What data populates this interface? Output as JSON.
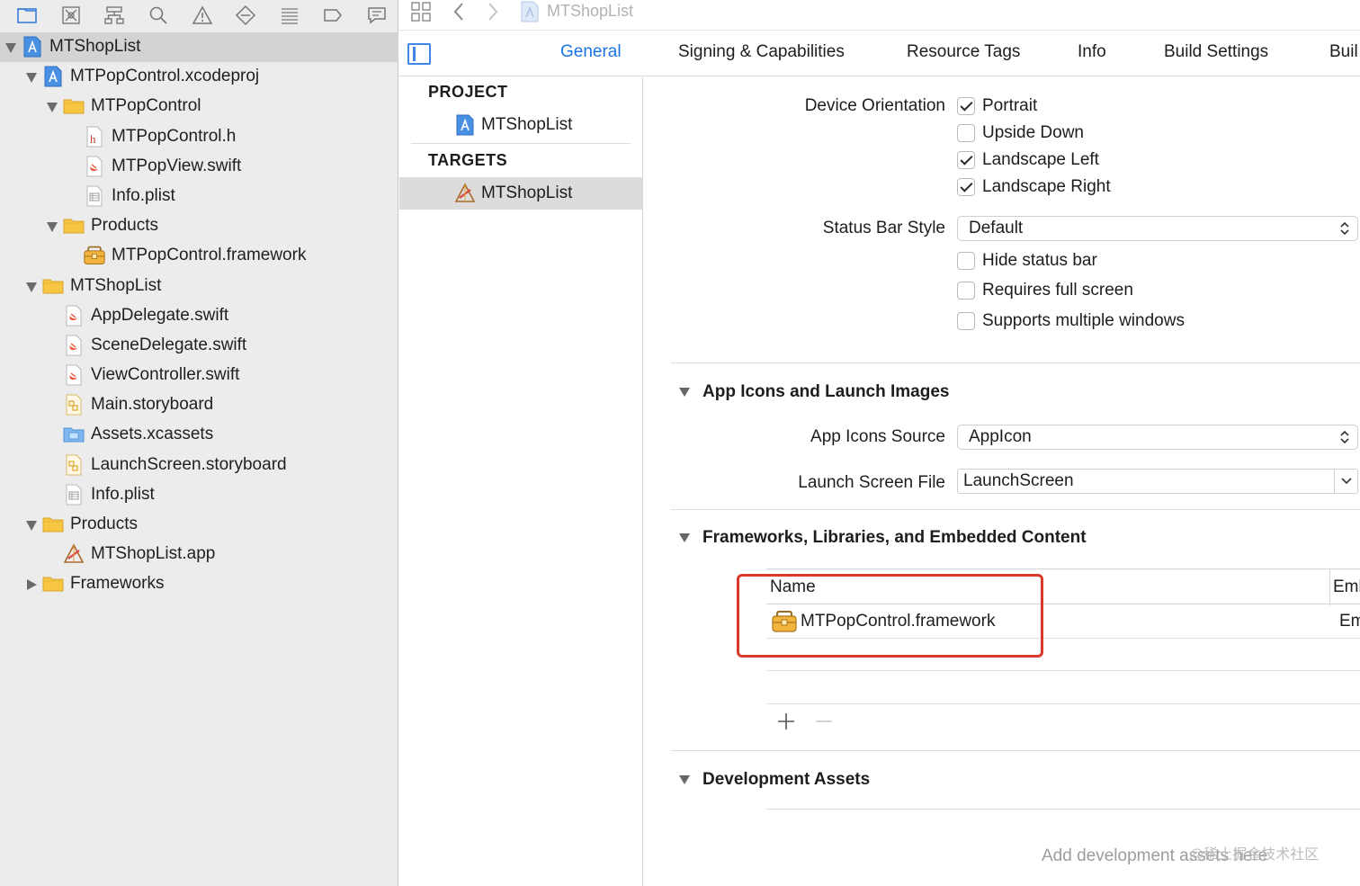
{
  "navigator": {
    "toolbar_icons": [
      "folder-icon",
      "source-control-icon",
      "hierarchy-icon",
      "search-icon",
      "warning-icon",
      "test-icon",
      "debug-icon",
      "breakpoint-icon",
      "report-icon"
    ],
    "tree": [
      {
        "label": "MTShopList",
        "level": 0,
        "expanded": true,
        "icon": "xcodeproj-icon",
        "selected": true
      },
      {
        "label": "MTPopControl.xcodeproj",
        "level": 1,
        "expanded": true,
        "icon": "xcodeproj-icon"
      },
      {
        "label": "MTPopControl",
        "level": 2,
        "expanded": true,
        "icon": "folder-icon"
      },
      {
        "label": "MTPopControl.h",
        "level": 3,
        "icon": "header-file-icon"
      },
      {
        "label": "MTPopView.swift",
        "level": 3,
        "icon": "swift-file-icon"
      },
      {
        "label": "Info.plist",
        "level": 3,
        "icon": "plist-file-icon"
      },
      {
        "label": "Products",
        "level": 2,
        "expanded": true,
        "icon": "folder-icon"
      },
      {
        "label": "MTPopControl.framework",
        "level": 3,
        "icon": "framework-icon"
      },
      {
        "label": "MTShopList",
        "level": 1,
        "expanded": true,
        "icon": "folder-icon"
      },
      {
        "label": "AppDelegate.swift",
        "level": 2,
        "icon": "swift-file-icon"
      },
      {
        "label": "SceneDelegate.swift",
        "level": 2,
        "icon": "swift-file-icon"
      },
      {
        "label": "ViewController.swift",
        "level": 2,
        "icon": "swift-file-icon"
      },
      {
        "label": "Main.storyboard",
        "level": 2,
        "icon": "storyboard-icon"
      },
      {
        "label": "Assets.xcassets",
        "level": 2,
        "icon": "assets-folder-icon"
      },
      {
        "label": "LaunchScreen.storyboard",
        "level": 2,
        "icon": "storyboard-icon"
      },
      {
        "label": "Info.plist",
        "level": 2,
        "icon": "plist-file-icon"
      },
      {
        "label": "Products",
        "level": 1,
        "expanded": true,
        "icon": "folder-icon"
      },
      {
        "label": "MTShopList.app",
        "level": 2,
        "icon": "app-target-icon"
      },
      {
        "label": "Frameworks",
        "level": 1,
        "expanded": false,
        "icon": "folder-icon"
      }
    ]
  },
  "editor_bar": {
    "title": "MTShopList"
  },
  "tabs": [
    {
      "label": "General",
      "active": true
    },
    {
      "label": "Signing & Capabilities"
    },
    {
      "label": "Resource Tags"
    },
    {
      "label": "Info"
    },
    {
      "label": "Build Settings"
    },
    {
      "label": "Buil"
    }
  ],
  "targets_list": {
    "project_header": "PROJECT",
    "project_item": "MTShopList",
    "targets_header": "TARGETS",
    "target_item": "MTShopList"
  },
  "settings": {
    "device_orientation": {
      "label": "Device Orientation",
      "options": [
        {
          "label": "Portrait",
          "checked": true
        },
        {
          "label": "Upside Down",
          "checked": false
        },
        {
          "label": "Landscape Left",
          "checked": true
        },
        {
          "label": "Landscape Right",
          "checked": true
        }
      ]
    },
    "status_bar": {
      "label": "Status Bar Style",
      "value": "Default",
      "options": [
        {
          "label": "Hide status bar",
          "checked": false
        },
        {
          "label": "Requires full screen",
          "checked": false
        },
        {
          "label": "Supports multiple windows",
          "checked": false
        }
      ]
    },
    "app_icons": {
      "title": "App Icons and Launch Images",
      "source_label": "App Icons Source",
      "source_value": "AppIcon",
      "launch_label": "Launch Screen File",
      "launch_value": "LaunchScreen"
    },
    "frameworks": {
      "title": "Frameworks, Libraries, and Embedded Content",
      "col_name": "Name",
      "col_embed": "Emb",
      "rows": [
        {
          "name": "MTPopControl.framework",
          "embed": "Em"
        }
      ],
      "add_symbol": "+",
      "remove_symbol": "−"
    },
    "dev_assets": {
      "title": "Development Assets",
      "placeholder": "Add development assets here"
    }
  },
  "watermark": "@稀土掘金技术社区",
  "colors": {
    "accent": "#1b73e8",
    "highlight_box": "#d9392b",
    "navigator_bg": "#ececec",
    "folder_yellow": "#f7c744"
  }
}
